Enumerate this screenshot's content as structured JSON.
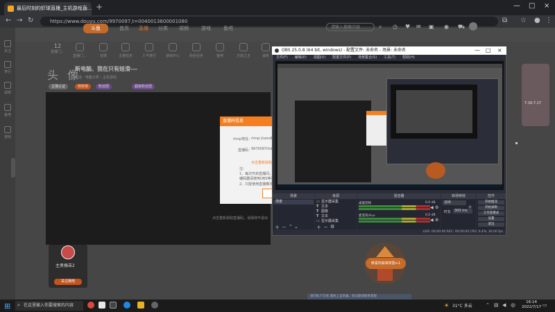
{
  "browser": {
    "tab_title": "最后时刻的虾球直播_主机游戏直…",
    "url": "https://www.douyu.com/9970097,t=0040013600001080"
  },
  "site": {
    "logo": "斗鱼",
    "nav": [
      "首页",
      "直播",
      "分类",
      "视频",
      "游戏",
      "鱼吧"
    ],
    "search_placeholder": "请输入搜索内容",
    "left_sidebar": [
      "关注",
      "排行",
      "视频",
      "鱼吧",
      "游戏"
    ],
    "categories": [
      "12",
      "直播门…",
      "音频",
      "主播任务",
      "人气排行",
      "游戏中心",
      "粉丝任务",
      "鱼吧",
      "万兽之王",
      "抽奖",
      "关注分享"
    ],
    "streamer_avatar_text": "头 像",
    "room_title": "新电脑、我在只有娃滑---",
    "room_sub": "频道 · 电脑分类 › 主机游戏",
    "pills": [
      "主播认证",
      "特权榜",
      "粉丝团",
      "超级粉丝团"
    ]
  },
  "dialog": {
    "header": "直播码信息",
    "rtmp_label": "rtmp地址：",
    "rtmp_value": "rtmp://sendtc3.douyu.com/live",
    "code_label": "直播码：",
    "code_value": "9970097rhdwe8g?wsSecret=",
    "reset_link": "点击重新获取直播码",
    "note_title": "注：",
    "note_1": "1、每次开启直播间，直播码会重新生成",
    "note_2": "编码器请使用OBS等第三方工具",
    "note_3": "2、只能使用直播推流地址，非正常使用会被限制",
    "bottom_text": "点击重新获取直播码，请保持不退出"
  },
  "obs": {
    "title": "OBS 25.0.8 (64 bit, windows) - 配置文件: 未命名 - 场景: 未命名",
    "menu": [
      "文件(F)",
      "编辑(E)",
      "视图(V)",
      "配置文件(P)",
      "场景集合(S)",
      "工具(T)",
      "帮助(H)"
    ],
    "docks": [
      "场景",
      "来源",
      "混音器",
      "转场特效",
      "控件"
    ],
    "scene": "场景",
    "sources": [
      "显示器采集",
      "文本",
      "图像",
      "文本",
      "显示器采集"
    ],
    "mixer": [
      {
        "name": "桌面音频",
        "db": "0.0 dB"
      },
      {
        "name": "麦克风/Aux",
        "db": "0.0 dB"
      }
    ],
    "transition": "淡出",
    "duration_label": "时长",
    "duration_value": "300 ms",
    "controls": [
      "开始推流",
      "开始录制",
      "工作室模式",
      "设置",
      "退出"
    ],
    "status": "LIVE: 00:00:00   REC: 00:00:00   CPU: 0.4%, 30.00 fps"
  },
  "lower": {
    "streamer_name": "主男搞击2",
    "follow_label": "关注我吧",
    "promo_text": "恭喜你获得奖励+1",
    "notice": "请勿私下交易 谨防上当受骗，有问题请联系客服"
  },
  "right_ad": {
    "text": "7.16-7.17"
  },
  "taskbar": {
    "search_placeholder": "在这里输入你要搜索的内容",
    "weather": "31°C 多云",
    "time": "16:14",
    "date": "2022/7/17"
  }
}
